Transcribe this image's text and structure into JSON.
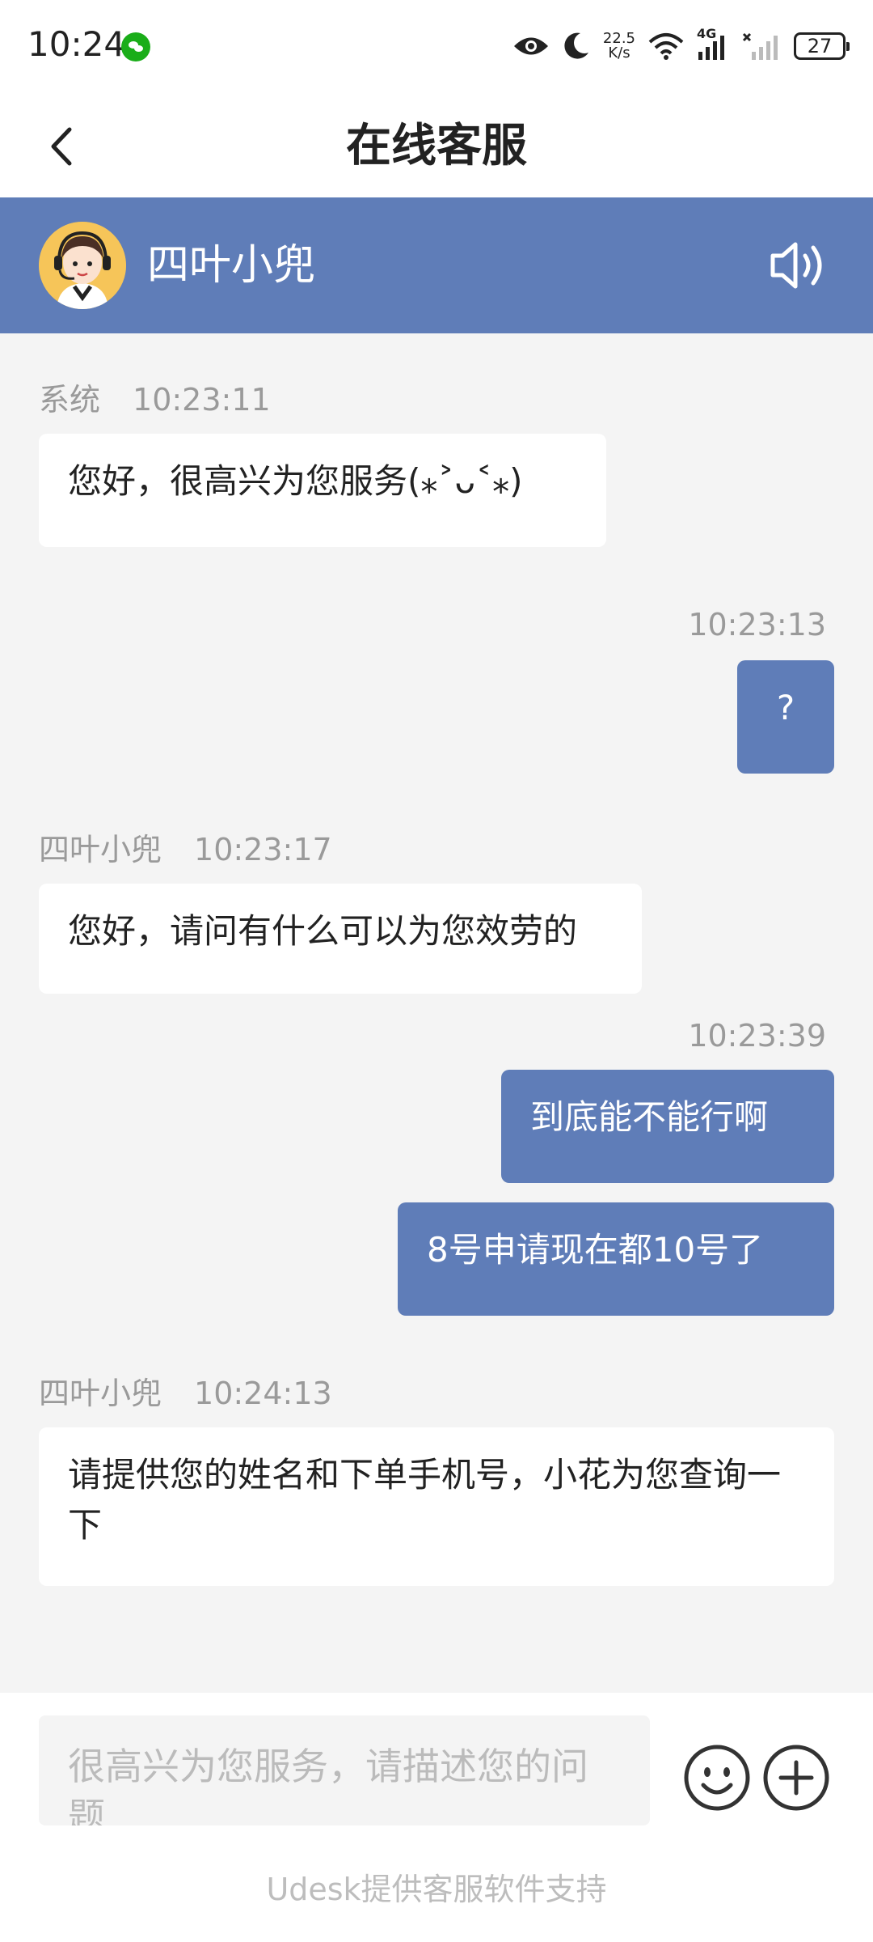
{
  "status_bar": {
    "time": "10:24",
    "net_speed_value": "22.5",
    "net_speed_unit": "K/s",
    "network_type": "4G",
    "battery": "27",
    "icons": [
      "wechat-icon",
      "eye-icon",
      "moon-icon",
      "wifi-icon",
      "signal-4g-icon",
      "signal-no-service-icon",
      "battery-icon"
    ]
  },
  "header": {
    "title": "在线客服"
  },
  "agent": {
    "name": "四叶小兜",
    "avatar_icon": "customer-service-agent-avatar",
    "speaker_icon": "speaker-icon"
  },
  "messages": [
    {
      "direction": "in",
      "sender": "系统",
      "time": "10:23:11",
      "text": "您好，很高兴为您服务(⁎˃ᴗ˂⁎)"
    },
    {
      "direction": "out",
      "time": "10:23:13",
      "text": "?"
    },
    {
      "direction": "in",
      "sender": "四叶小兜",
      "time": "10:23:17",
      "text": "您好，请问有什么可以为您效劳的"
    },
    {
      "direction": "out",
      "time": "10:23:39",
      "text": "到底能不能行啊"
    },
    {
      "direction": "out",
      "text": "8号申请现在都10号了"
    },
    {
      "direction": "in",
      "sender": "四叶小兜",
      "time": "10:24:13",
      "text": "请提供您的姓名和下单手机号，小花为您查询一下"
    }
  ],
  "input": {
    "placeholder": "很高兴为您服务，请描述您的问题",
    "emoji_icon": "emoji-icon",
    "plus_icon": "plus-icon"
  },
  "footer": {
    "note": "Udesk提供客服软件支持"
  },
  "colors": {
    "accent": "#5f7db8",
    "background": "#f4f4f4",
    "bubble_in": "#ffffff",
    "text_muted": "#9a9a9a"
  }
}
